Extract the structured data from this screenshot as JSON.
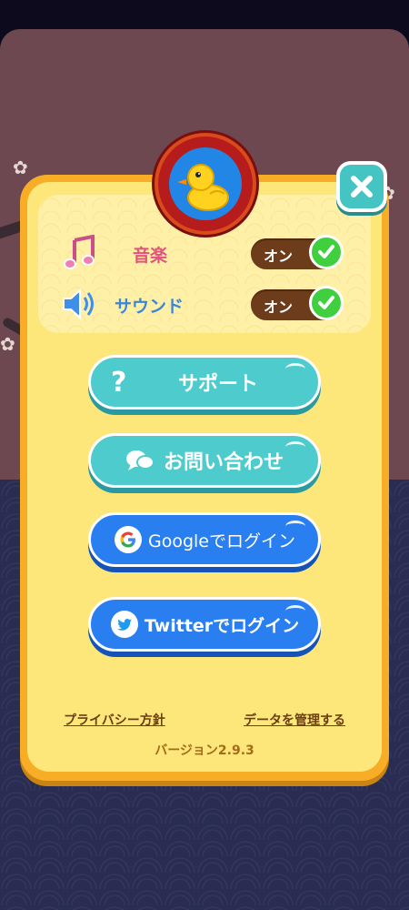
{
  "settings": {
    "music": {
      "label": "音楽",
      "toggle": "オン",
      "icon": "music-note-icon"
    },
    "sound": {
      "label": "サウンド",
      "toggle": "オン",
      "icon": "speaker-icon"
    }
  },
  "buttons": {
    "support": "サポート",
    "contact": "お問い合わせ",
    "google_login": "Googleでログイン",
    "twitter_login": "Twitterでログイン"
  },
  "footer": {
    "privacy": "プライバシー方針",
    "manage_data": "データを管理する",
    "version": "バージョン2.9.3"
  },
  "colors": {
    "panel": "#f7ae26",
    "teal_button": "#4ecbcd",
    "blue_button": "#2a7ff0",
    "toggle_on": "#3fcf3f"
  }
}
